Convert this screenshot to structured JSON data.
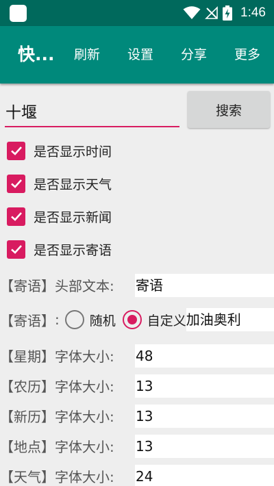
{
  "status": {
    "time": "1:46"
  },
  "appbar": {
    "title": "快...",
    "menu": [
      "刷新",
      "设置",
      "分享",
      "更多"
    ]
  },
  "search": {
    "value": "十堰",
    "button": "搜索"
  },
  "options": [
    {
      "label": "是否显示时间",
      "checked": true
    },
    {
      "label": "是否显示天气",
      "checked": true
    },
    {
      "label": "是否显示新闻",
      "checked": true
    },
    {
      "label": "是否显示寄语",
      "checked": true
    }
  ],
  "header_text": {
    "tag": "【寄语】",
    "label": "头部文本:",
    "value": "寄语"
  },
  "message": {
    "tag": "【寄语】",
    "label": ":",
    "random_label": "随机",
    "custom_label": "自定义",
    "custom_value": "加油奥利",
    "selected": "custom"
  },
  "font_sizes": [
    {
      "tag": "【星期】",
      "label": "字体大小:",
      "value": "48"
    },
    {
      "tag": "【农历】",
      "label": "字体大小:",
      "value": "13"
    },
    {
      "tag": "【新历】",
      "label": "字体大小:",
      "value": "13"
    },
    {
      "tag": "【地点】",
      "label": "字体大小:",
      "value": "13"
    },
    {
      "tag": "【天气】",
      "label": "字体大小:",
      "value": "24"
    }
  ],
  "colors": {
    "primary": "#00897b",
    "primary_dark": "#00695c",
    "accent": "#d81b60"
  }
}
